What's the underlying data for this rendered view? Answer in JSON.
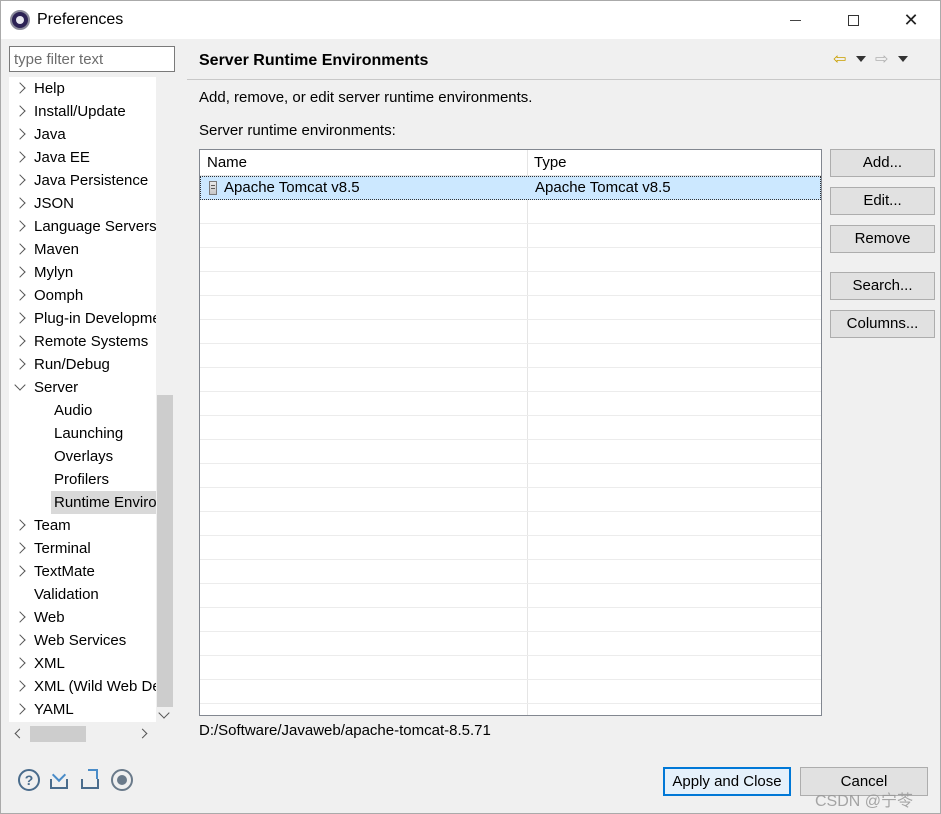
{
  "window": {
    "title": "Preferences"
  },
  "filter": {
    "placeholder": "type filter text"
  },
  "tree": {
    "items": [
      {
        "label": "Help",
        "level": 0,
        "expanded": false
      },
      {
        "label": "Install/Update",
        "level": 0,
        "expanded": false
      },
      {
        "label": "Java",
        "level": 0,
        "expanded": false
      },
      {
        "label": "Java EE",
        "level": 0,
        "expanded": false
      },
      {
        "label": "Java Persistence",
        "level": 0,
        "expanded": false
      },
      {
        "label": "JSON",
        "level": 0,
        "expanded": false
      },
      {
        "label": "Language Servers",
        "level": 0,
        "expanded": false
      },
      {
        "label": "Maven",
        "level": 0,
        "expanded": false
      },
      {
        "label": "Mylyn",
        "level": 0,
        "expanded": false
      },
      {
        "label": "Oomph",
        "level": 0,
        "expanded": false
      },
      {
        "label": "Plug-in Development",
        "level": 0,
        "expanded": false
      },
      {
        "label": "Remote Systems",
        "level": 0,
        "expanded": false
      },
      {
        "label": "Run/Debug",
        "level": 0,
        "expanded": false
      },
      {
        "label": "Server",
        "level": 0,
        "expanded": true
      },
      {
        "label": "Audio",
        "level": 1
      },
      {
        "label": "Launching",
        "level": 1
      },
      {
        "label": "Overlays",
        "level": 1
      },
      {
        "label": "Profilers",
        "level": 1
      },
      {
        "label": "Runtime Environments",
        "level": 1,
        "selected": true
      },
      {
        "label": "Team",
        "level": 0,
        "expanded": false
      },
      {
        "label": "Terminal",
        "level": 0,
        "expanded": false
      },
      {
        "label": "TextMate",
        "level": 0,
        "expanded": false
      },
      {
        "label": "Validation",
        "level": 0,
        "leaf": true
      },
      {
        "label": "Web",
        "level": 0,
        "expanded": false
      },
      {
        "label": "Web Services",
        "level": 0,
        "expanded": false
      },
      {
        "label": "XML",
        "level": 0,
        "expanded": false
      },
      {
        "label": "XML (Wild Web Developer)",
        "level": 0,
        "expanded": false
      },
      {
        "label": "YAML",
        "level": 0,
        "expanded": false
      }
    ]
  },
  "page": {
    "title": "Server Runtime Environments",
    "description": "Add, remove, or edit server runtime environments.",
    "list_label": "Server runtime environments:",
    "columns": [
      "Name",
      "Type"
    ],
    "rows": [
      {
        "name": "Apache Tomcat v8.5",
        "type": "Apache Tomcat v8.5",
        "selected": true
      }
    ],
    "path": "D:/Software/Javaweb/apache-tomcat-8.5.71"
  },
  "buttons": {
    "add": "Add...",
    "edit": "Edit...",
    "remove": "Remove",
    "search": "Search...",
    "columns": "Columns..."
  },
  "footer": {
    "apply_close": "Apply and Close",
    "cancel": "Cancel"
  },
  "watermark": "CSDN @宁苓",
  "icons": {
    "nav_back": "left-arrow-icon",
    "nav_forward": "right-arrow-icon"
  }
}
